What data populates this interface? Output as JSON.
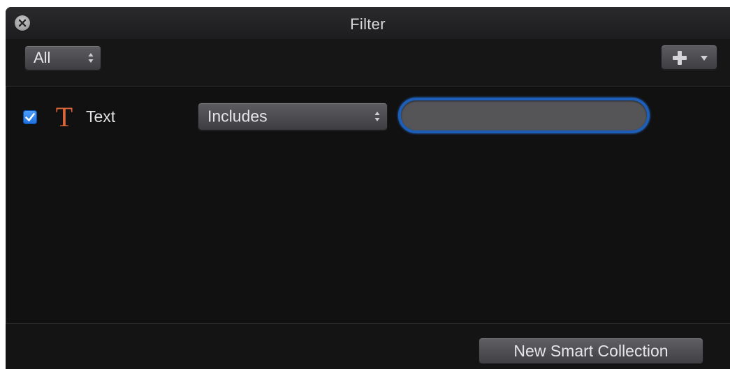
{
  "window": {
    "title": "Filter"
  },
  "toolbar": {
    "match_selector": {
      "selected": "All",
      "icon": "up-down-arrows-icon"
    },
    "add_rule_button": {
      "icon": "plus-icon",
      "menu_icon": "caret-down-icon"
    }
  },
  "rules": [
    {
      "enabled": true,
      "type_icon": "text-type-icon",
      "label": "Text",
      "operator": "Includes",
      "value": "",
      "focused": true
    }
  ],
  "footer": {
    "new_smart_collection_label": "New Smart Collection"
  },
  "colors": {
    "window_bg": "#111112",
    "text_icon": "#d9673b",
    "focus_ring": "#1d5fb8",
    "checkbox": "#2b7de9"
  }
}
